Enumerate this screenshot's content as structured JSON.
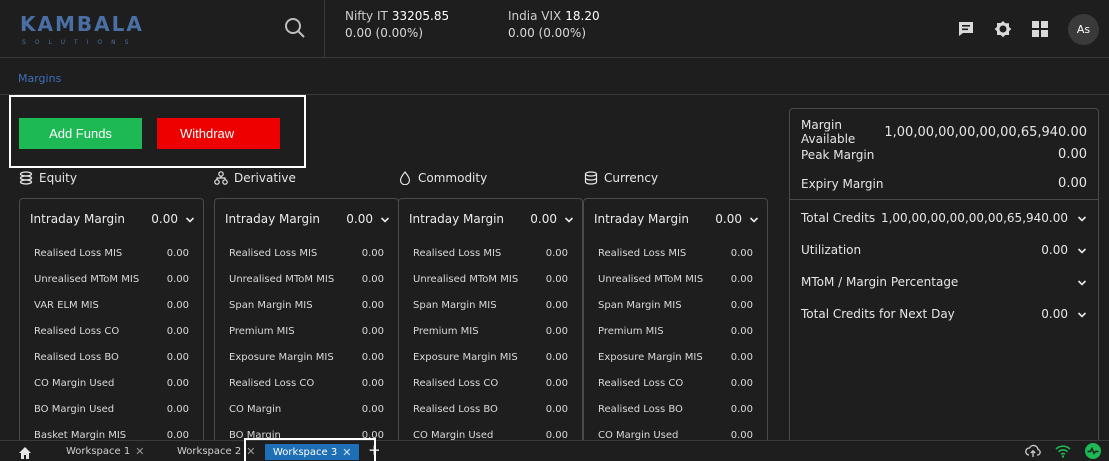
{
  "brand": {
    "name": "KAMBALA",
    "sub": "SOLUTIONS"
  },
  "tickers": [
    {
      "name": "Nifty IT",
      "value": "33205.85",
      "change": "0.00 (0.00%)"
    },
    {
      "name": "India VIX",
      "value": "18.20",
      "change": "0.00 (0.00%)"
    }
  ],
  "header": {
    "avatar": "As"
  },
  "breadcrumb": "Margins",
  "actions": {
    "add_funds": "Add Funds",
    "withdraw": "Withdraw"
  },
  "segments": [
    {
      "name": "Equity",
      "icon": "equity-icon",
      "header_label": "Intraday Margin",
      "header_value": "0.00",
      "rows": [
        {
          "label": "Realised Loss MIS",
          "value": "0.00"
        },
        {
          "label": "Unrealised MToM MIS",
          "value": "0.00"
        },
        {
          "label": "VAR ELM MIS",
          "value": "0.00"
        },
        {
          "label": "Realised Loss CO",
          "value": "0.00"
        },
        {
          "label": "Realised Loss BO",
          "value": "0.00"
        },
        {
          "label": "CO Margin Used",
          "value": "0.00"
        },
        {
          "label": "BO Margin Used",
          "value": "0.00"
        },
        {
          "label": "Basket Margin MIS",
          "value": "0.00"
        }
      ]
    },
    {
      "name": "Derivative",
      "icon": "derivative-icon",
      "header_label": "Intraday Margin",
      "header_value": "0.00",
      "rows": [
        {
          "label": "Realised Loss MIS",
          "value": "0.00"
        },
        {
          "label": "Unrealised MToM MIS",
          "value": "0.00"
        },
        {
          "label": "Span Margin MIS",
          "value": "0.00"
        },
        {
          "label": "Premium MIS",
          "value": "0.00"
        },
        {
          "label": "Exposure Margin MIS",
          "value": "0.00"
        },
        {
          "label": "Realised Loss CO",
          "value": "0.00"
        },
        {
          "label": "CO Margin",
          "value": "0.00"
        },
        {
          "label": "BO Margin",
          "value": "0.00"
        }
      ]
    },
    {
      "name": "Commodity",
      "icon": "commodity-icon",
      "header_label": "Intraday Margin",
      "header_value": "0.00",
      "rows": [
        {
          "label": "Realised Loss MIS",
          "value": "0.00"
        },
        {
          "label": "Unrealised MToM MIS",
          "value": "0.00"
        },
        {
          "label": "Span Margin MIS",
          "value": "0.00"
        },
        {
          "label": "Premium MIS",
          "value": "0.00"
        },
        {
          "label": "Exposure Margin MIS",
          "value": "0.00"
        },
        {
          "label": "Realised Loss CO",
          "value": "0.00"
        },
        {
          "label": "Realised Loss BO",
          "value": "0.00"
        },
        {
          "label": "CO Margin Used",
          "value": "0.00"
        }
      ]
    },
    {
      "name": "Currency",
      "icon": "currency-icon",
      "header_label": "Intraday Margin",
      "header_value": "0.00",
      "rows": [
        {
          "label": "Realised Loss MIS",
          "value": "0.00"
        },
        {
          "label": "Unrealised MToM MIS",
          "value": "0.00"
        },
        {
          "label": "Span Margin MIS",
          "value": "0.00"
        },
        {
          "label": "Premium MIS",
          "value": "0.00"
        },
        {
          "label": "Exposure Margin MIS",
          "value": "0.00"
        },
        {
          "label": "Realised Loss CO",
          "value": "0.00"
        },
        {
          "label": "Realised Loss BO",
          "value": "0.00"
        },
        {
          "label": "CO Margin Used",
          "value": "0.00"
        }
      ]
    }
  ],
  "summary": {
    "margin_available": {
      "label": "Margin Available",
      "value": "1,00,00,00,00,00,00,65,940.00"
    },
    "peak_margin": {
      "label": "Peak Margin",
      "value": "0.00"
    },
    "expiry_margin": {
      "label": "Expiry Margin",
      "value": "0.00"
    },
    "total_credits": {
      "label": "Total Credits",
      "value": "1,00,00,00,00,00,00,65,940.00"
    },
    "utilization": {
      "label": "Utilization",
      "value": "0.00"
    },
    "mtom_pct": {
      "label": "MToM / Margin Percentage",
      "value": ""
    },
    "next_day": {
      "label": "Total Credits for Next Day",
      "value": "0.00"
    }
  },
  "workspaces": [
    {
      "label": "Workspace 1",
      "active": false
    },
    {
      "label": "Workspace 2",
      "active": false
    },
    {
      "label": "Workspace 3",
      "active": true
    }
  ],
  "colors": {
    "accent": "#1e6fb5",
    "add": "#1db954",
    "withdraw": "#ee0000",
    "link": "#3d6fb8",
    "online": "#1db954"
  }
}
